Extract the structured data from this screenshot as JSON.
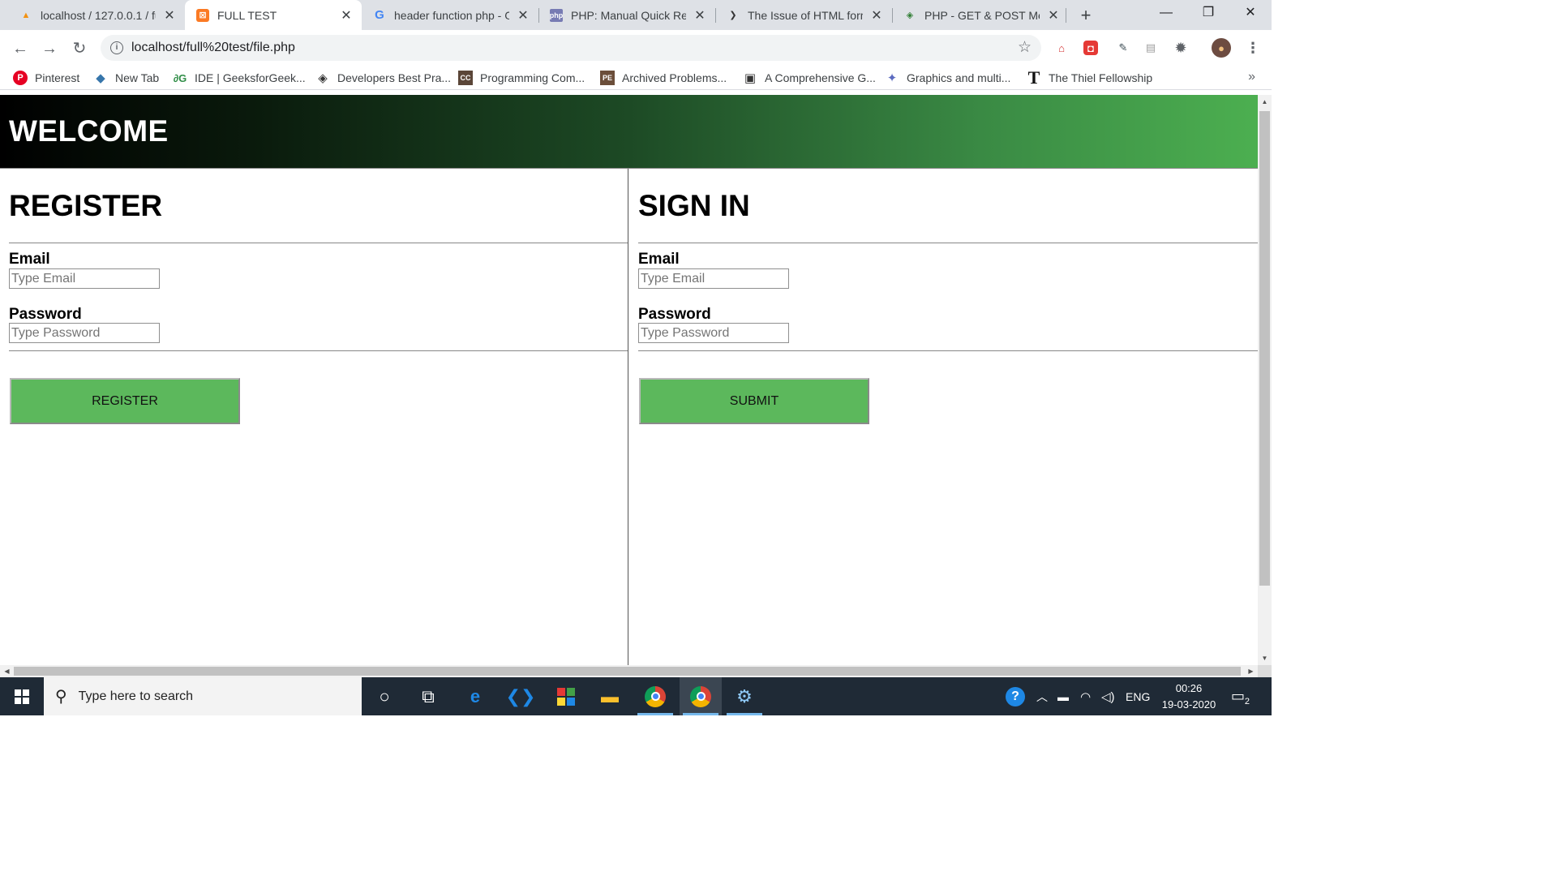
{
  "browser": {
    "tabs": [
      {
        "title": "localhost / 127.0.0.1 / fu",
        "favicon": "phpmyadmin-icon"
      },
      {
        "title": "FULL TEST",
        "favicon": "xampp-icon"
      },
      {
        "title": "header function php - G",
        "favicon": "google-icon"
      },
      {
        "title": "PHP: Manual Quick Refe",
        "favicon": "php-icon"
      },
      {
        "title": "The Issue of HTML form",
        "favicon": "tutorial-icon"
      },
      {
        "title": "PHP - GET & POST Met",
        "favicon": "tutorialspoint-icon"
      }
    ],
    "active_tab_index": 1,
    "address": "localhost/full%20test/file.php",
    "bookmarks": [
      {
        "label": "Pinterest"
      },
      {
        "label": "New Tab"
      },
      {
        "label": "IDE | GeeksforGeek..."
      },
      {
        "label": "Developers Best Pra..."
      },
      {
        "label": "Programming Com..."
      },
      {
        "label": "Archived Problems..."
      },
      {
        "label": "A Comprehensive G..."
      },
      {
        "label": "Graphics and multi..."
      },
      {
        "label": "The Thiel Fellowship"
      }
    ],
    "bookmarks_more": "»"
  },
  "page": {
    "header": "WELCOME",
    "register": {
      "heading": "REGISTER",
      "email_label": "Email",
      "email_placeholder": "Type Email",
      "password_label": "Password",
      "password_placeholder": "Type Password",
      "button": "REGISTER"
    },
    "signin": {
      "heading": "SIGN IN",
      "email_label": "Email",
      "email_placeholder": "Type Email",
      "password_label": "Password",
      "password_placeholder": "Type Password",
      "button": "SUBMIT"
    },
    "colors": {
      "button_green": "#5cb85c",
      "header_gradient_end": "#4caf50"
    }
  },
  "taskbar": {
    "search_placeholder": "Type here to search",
    "language": "ENG",
    "time": "00:26",
    "date": "19-03-2020",
    "notifications": "2"
  }
}
